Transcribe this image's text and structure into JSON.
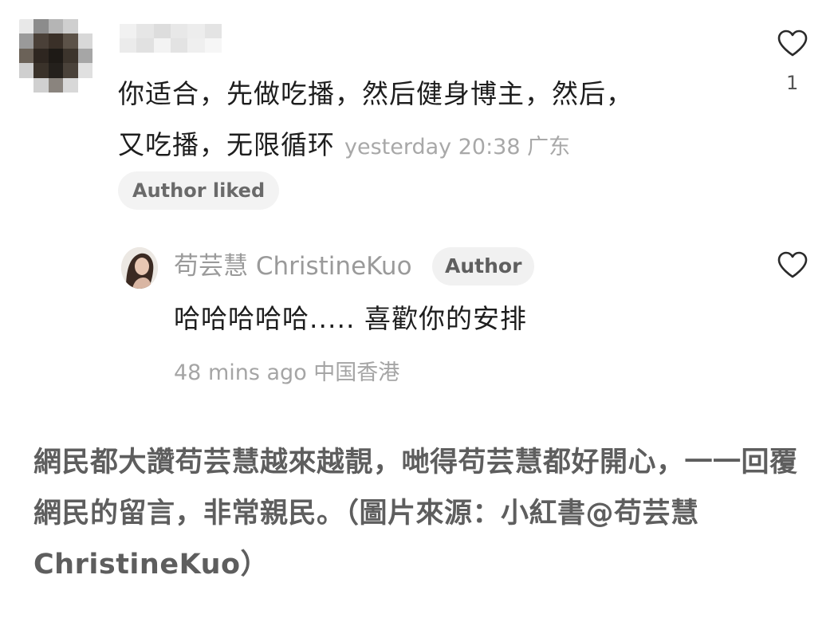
{
  "comment": {
    "text_line1": "你适合，先做吃播，然后健身博主，然后，",
    "text_line2": "又吃播，无限循环",
    "meta": "yesterday 20:38 广东",
    "author_liked_label": "Author liked",
    "like_count": "1"
  },
  "reply": {
    "author_name": "苟芸慧 ChristineKuo",
    "author_badge": "Author",
    "text": "哈哈哈哈哈..... 喜歡你的安排",
    "meta": "48 mins ago 中国香港"
  },
  "caption": {
    "text": "網民都大讚苟芸慧越來越靚，哋得苟芸慧都好開心，一一回覆網民的留言，非常親民。（圖片來源：小紅書@苟芸慧ChristineKuo）"
  },
  "colors": {
    "heart_stroke": "#2a2a2a",
    "meta_gray": "#a8a8a8",
    "badge_bg": "#f3f3f3"
  },
  "icons": [
    "heart-outline-icon"
  ]
}
